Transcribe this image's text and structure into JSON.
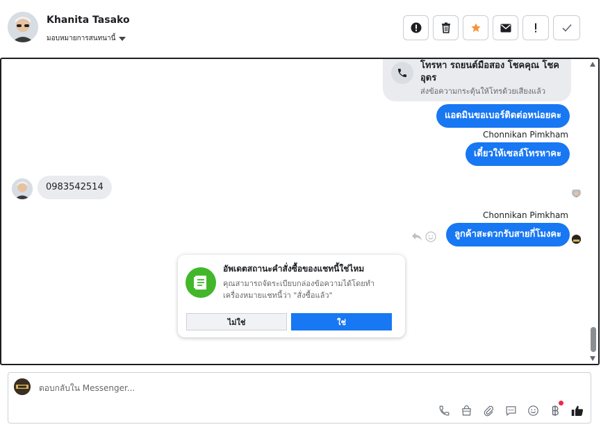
{
  "header": {
    "name": "Khanita Tasako",
    "assign_label": "มอบหมายการสนทนานี้",
    "actions": [
      "report",
      "delete",
      "star",
      "mark-unread",
      "spam",
      "done"
    ]
  },
  "conversation": {
    "call_card": {
      "title": "โทรหา รถยนต์มือสอง โชคคุณ โชค อุดร",
      "subtitle": "ส่งข้อความกระตุ้นให้โทรด้วยเสียงแล้ว"
    },
    "messages": [
      {
        "direction": "out",
        "text": "แอดมินขอเบอร์ติดต่อหน่อยคะ"
      },
      {
        "direction": "out",
        "sender": "Chonnikan Pimkham",
        "text": "เดี๋ยวให้เซลล์โทรหาคะ"
      },
      {
        "direction": "in",
        "text": "0983542514"
      },
      {
        "direction": "out",
        "sender": "Chonnikan Pimkham",
        "text": "ลูกค้าสะดวกรับสายกี่โมงคะ"
      }
    ],
    "popup": {
      "title": "อัพเดตสถานะคำสั่งซื้อของแชทนี้ใช่ไหม",
      "description": "คุณสามารถจัดระเบียบกล่องข้อความได้โดยทำเครื่องหมายแชทนี้ว่า \"สั่งซื้อแล้ว\"",
      "no_label": "ไม่ใช่",
      "yes_label": "ใช่"
    }
  },
  "composer": {
    "placeholder": "ตอบกลับใน Messenger...",
    "tools": [
      "phone-icon",
      "shopping-bag-icon",
      "paperclip-icon",
      "saved-reply-icon",
      "emoji-icon",
      "baht-icon",
      "like-icon"
    ]
  },
  "colors": {
    "accent": "#1877f2",
    "bubble_in": "#e9ebee",
    "popup_icon": "#42b72a",
    "star": "#f7923a",
    "notification_dot": "#f02849"
  }
}
